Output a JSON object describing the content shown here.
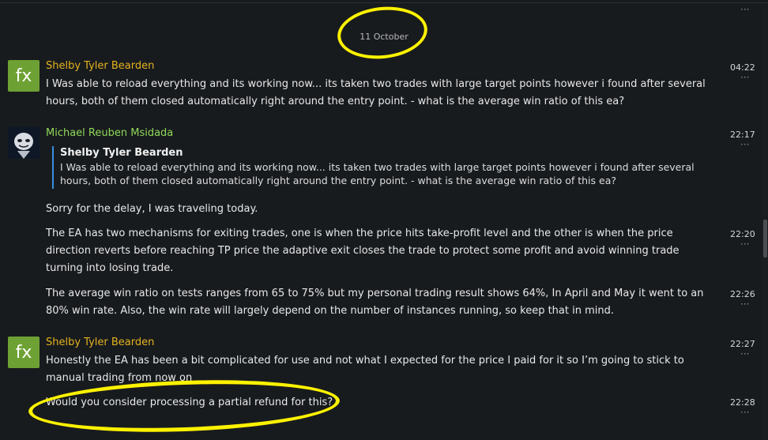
{
  "date_separator": "11 October",
  "messages": [
    {
      "author": "Shelby Tyler Bearden",
      "avatar": "fx",
      "time": "04:22",
      "text": "I Was able to reload everything and its working now... its taken two trades with large target points however i found after several hours, both of them closed automatically right around the entry point. - what is the average win ratio of this ea?"
    },
    {
      "author": "Michael Reuben Msidada",
      "avatar": "face-avatar",
      "time": "22:17",
      "quote_author": "Shelby Tyler Bearden",
      "quote_text": "I Was able to reload everything and its working now... its taken two trades with large target points however i found after several hours, both of them closed automatically right around the entry point. - what is the average win ratio of this ea?",
      "text": "Sorry for the delay, I was traveling today."
    },
    {
      "time": "22:20",
      "text": "The EA has two mechanisms for exiting trades, one is when the price hits take-profit level and the other is when the price direction reverts before reaching TP price the adaptive exit closes the trade to protect some profit and avoid winning trade turning into losing trade."
    },
    {
      "time": "22:26",
      "text": "The average win ratio on tests ranges from 65 to 75% but my personal trading result shows 64%, In April and May it went to an 80% win rate. Also, the win rate will largely depend on the number of instances running, so keep that in mind."
    },
    {
      "author": "Shelby Tyler Bearden",
      "avatar": "fx",
      "time": "22:27",
      "text": "Honestly the EA has been a bit complicated for use and not what I expected for the price I paid for it so I’m going to stick to manual trading from now on"
    },
    {
      "time": "22:28",
      "text": "Would you consider processing a partial refund for this?"
    }
  ],
  "more_icon": "···",
  "colors": {
    "background": "#181b1e",
    "author_yellow": "#e4b21e",
    "author_green": "#8fd95a",
    "quote_bar": "#3a8ee0",
    "highlight": "#fff200",
    "fx_avatar": "#6ea133"
  }
}
